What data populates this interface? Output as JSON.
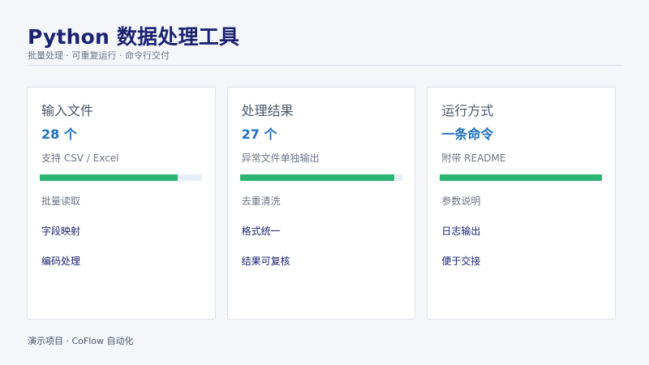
{
  "header": {
    "title": "Python 数据处理工具",
    "subtitle": "批量处理 · 可重复运行 · 命令行交付"
  },
  "cards": [
    {
      "title": "输入文件",
      "value": "28 个",
      "desc": "支持 CSV / Excel",
      "progress": 0.85,
      "items": [
        "批量读取",
        "字段映射",
        "编码处理"
      ]
    },
    {
      "title": "处理结果",
      "value": "27 个",
      "desc": "异常文件单独输出",
      "progress": 0.95,
      "items": [
        "去重清洗",
        "格式统一",
        "结果可复核"
      ]
    },
    {
      "title": "运行方式",
      "value": "一条命令",
      "desc": "附带 README",
      "progress": 1.0,
      "items": [
        "参数说明",
        "日志输出",
        "便于交接"
      ]
    }
  ],
  "footer": {
    "text": "演示项目 · CoFlow 自动化"
  },
  "colors": {
    "title": "#1b2270",
    "accent": "#1f6fc0",
    "progress": "#2bb673",
    "track": "#e8eef7"
  }
}
